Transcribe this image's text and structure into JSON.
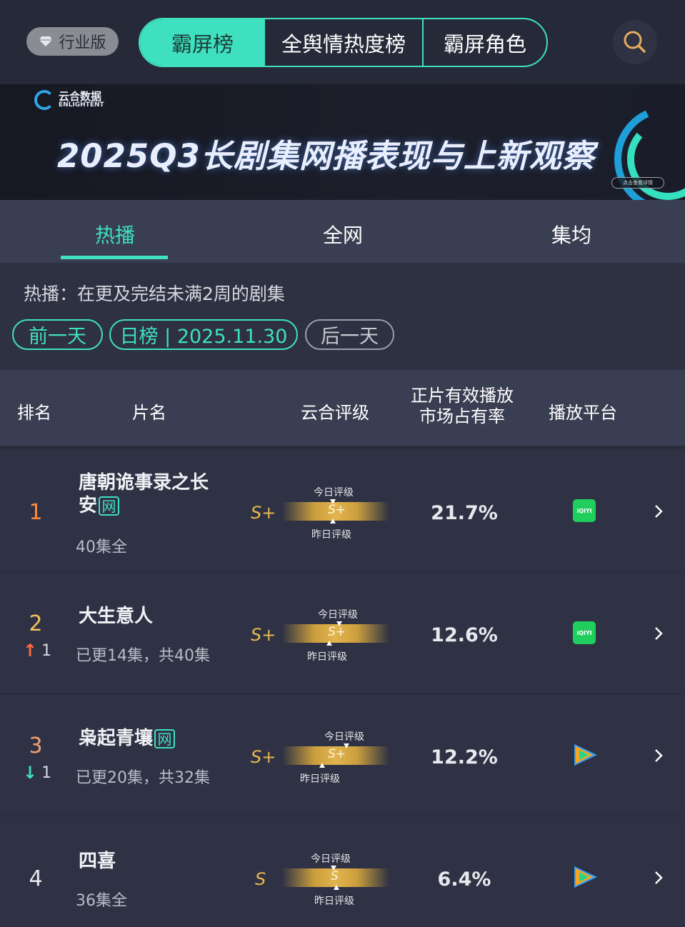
{
  "header": {
    "industry_label": "行业版",
    "tabs": [
      {
        "label": "霸屏榜",
        "active": true
      },
      {
        "label": "全舆情热度榜",
        "active": false
      },
      {
        "label": "霸屏角色",
        "active": false
      }
    ],
    "accent_color": "#3fe0bf"
  },
  "banner": {
    "logo_cn": "云合数据",
    "logo_en": "ENLIGHTENT",
    "title": "2025Q3长剧集网播表现与上新观察",
    "pill": "点击查看详情"
  },
  "subtabs": [
    {
      "label": "热播",
      "active": true
    },
    {
      "label": "全网",
      "active": false
    },
    {
      "label": "集均",
      "active": false
    }
  ],
  "filter": {
    "description": "热播：在更及完结未满2周的剧集",
    "prev_label": "前一天",
    "date_label": "日榜 | 2025.11.30",
    "next_label": "后一天"
  },
  "table": {
    "headers": {
      "rank": "排名",
      "name": "片名",
      "rating": "云合评级",
      "share_line1": "正片有效播放",
      "share_line2": "市场占有率",
      "platform": "播放平台"
    },
    "rows": [
      {
        "rank": "1",
        "rank_color": "#ff8a3d",
        "change": "",
        "title": "唐朝诡事录之长安",
        "net_tag": "网",
        "episodes": "40集全",
        "grade": "S+",
        "today_label": "今日评级",
        "yesterday_label": "昨日评级",
        "bar_grade": "S+",
        "share": "21.7%",
        "platform": "iqiyi-icon"
      },
      {
        "rank": "2",
        "rank_color": "#f5c15a",
        "change": "1",
        "change_dir": "up",
        "title": "大生意人",
        "net_tag": "",
        "episodes": "已更14集，共40集",
        "grade": "S+",
        "today_label": "今日评级",
        "yesterday_label": "昨日评级",
        "bar_grade": "S+",
        "share": "12.6%",
        "platform": "iqiyi-icon"
      },
      {
        "rank": "3",
        "rank_color": "#f0a070",
        "change": "1",
        "change_dir": "down",
        "title": "枭起青壤",
        "net_tag": "网",
        "episodes": "已更20集，共32集",
        "grade": "S+",
        "today_label": "今日评级",
        "yesterday_label": "昨日评级",
        "bar_grade": "S+",
        "share": "12.2%",
        "platform": "tencent-video-icon"
      },
      {
        "rank": "4",
        "rank_color": "#e8e9ee",
        "change": "",
        "title": "四喜",
        "net_tag": "",
        "episodes": "36集全",
        "grade": "S",
        "today_label": "今日评级",
        "yesterday_label": "昨日评级",
        "bar_grade": "S",
        "share": "6.4%",
        "platform": "tencent-video-icon"
      }
    ],
    "iqiyi_text": "iQIYI"
  }
}
